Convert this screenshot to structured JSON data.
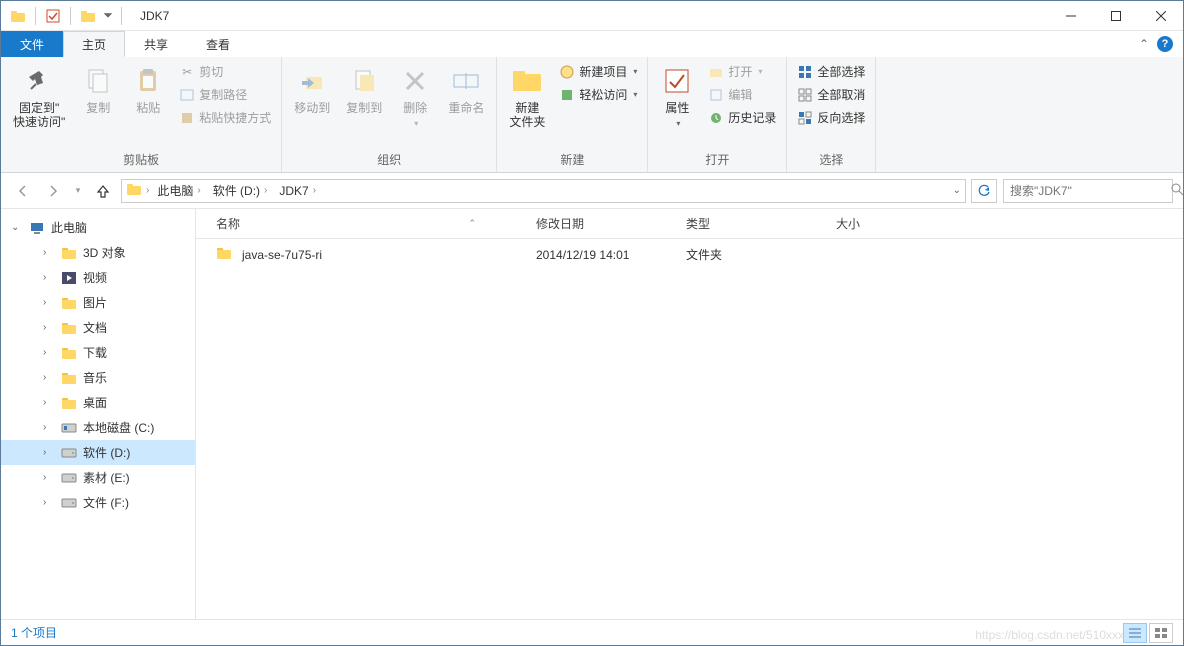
{
  "title": "JDK7",
  "tabs": {
    "file": "文件",
    "home": "主页",
    "share": "共享",
    "view": "查看"
  },
  "ribbon": {
    "clipboard": {
      "label": "剪贴板",
      "pin": "固定到\"\n快速访问\"",
      "copy": "复制",
      "paste": "粘贴",
      "cut": "剪切",
      "copypath": "复制路径",
      "pasteshortcut": "粘贴快捷方式"
    },
    "organize": {
      "label": "组织",
      "moveto": "移动到",
      "copyto": "复制到",
      "delete": "删除",
      "rename": "重命名"
    },
    "new": {
      "label": "新建",
      "newfolder": "新建\n文件夹",
      "newitem": "新建项目",
      "easyaccess": "轻松访问"
    },
    "open": {
      "label": "打开",
      "properties": "属性",
      "open": "打开",
      "edit": "编辑",
      "history": "历史记录"
    },
    "select": {
      "label": "选择",
      "all": "全部选择",
      "none": "全部取消",
      "invert": "反向选择"
    }
  },
  "breadcrumbs": [
    "此电脑",
    "软件 (D:)",
    "JDK7"
  ],
  "search_placeholder": "搜索\"JDK7\"",
  "tree": {
    "root": "此电脑",
    "items": [
      {
        "label": "3D 对象"
      },
      {
        "label": "视频"
      },
      {
        "label": "图片"
      },
      {
        "label": "文档"
      },
      {
        "label": "下载"
      },
      {
        "label": "音乐"
      },
      {
        "label": "桌面"
      },
      {
        "label": "本地磁盘 (C:)"
      },
      {
        "label": "软件 (D:)",
        "selected": true
      },
      {
        "label": "素材 (E:)"
      },
      {
        "label": "文件 (F:)"
      }
    ]
  },
  "columns": {
    "name": "名称",
    "date": "修改日期",
    "type": "类型",
    "size": "大小"
  },
  "rows": [
    {
      "name": "java-se-7u75-ri",
      "date": "2014/12/19 14:01",
      "type": "文件夹",
      "size": ""
    }
  ],
  "status": "1 个项目",
  "watermark": "https://blog.csdn.net/510xxx"
}
